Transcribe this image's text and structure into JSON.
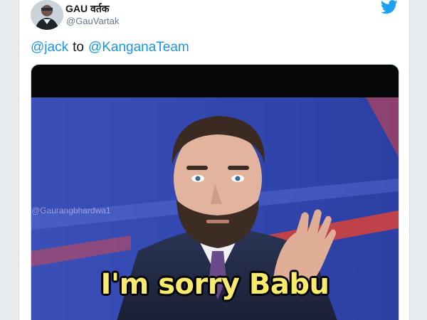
{
  "tweet": {
    "author": {
      "display_name": "GAU वर्तक",
      "handle": "@GauVartak"
    },
    "icons": {
      "avatar": "avatar-photo",
      "logo": "twitter-bird-icon"
    },
    "text": {
      "mention_from": "@jack",
      "connector": "to",
      "mention_to": "@KanganaTeam"
    },
    "media": {
      "watermark": "@Gaurangbhardwa1",
      "caption": "I'm sorry Babu"
    }
  },
  "colors": {
    "link": "#1b95e0",
    "twitter_blue": "#1da1f2",
    "caption_yellow": "#f7ea6c"
  }
}
